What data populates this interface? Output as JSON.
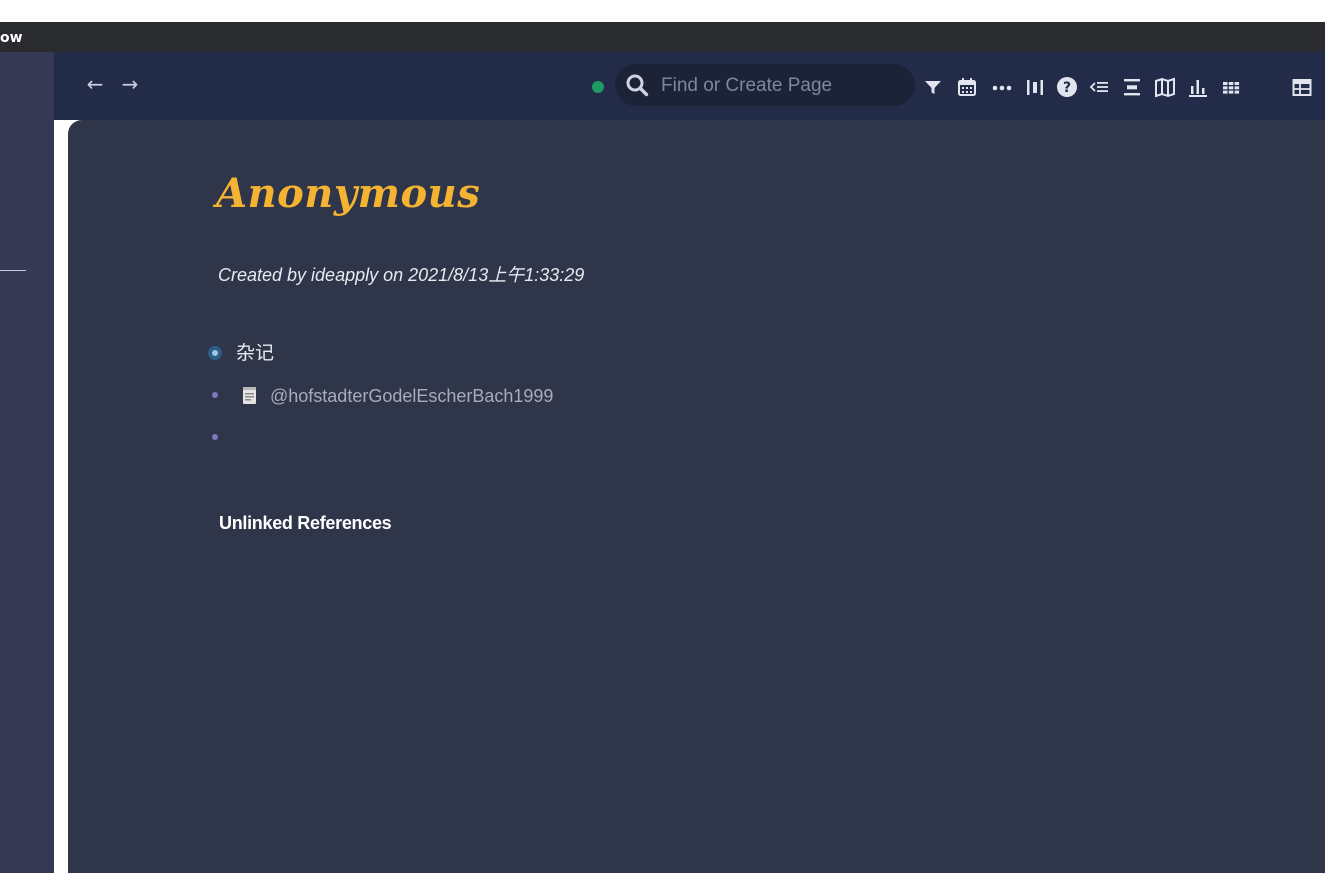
{
  "window": {
    "title": "ow"
  },
  "topbar": {
    "back_arrow": "←",
    "forward_arrow": "→",
    "search": {
      "placeholder": "Find or Create Page",
      "value": ""
    },
    "icons": [
      "filter-icon",
      "calendar-icon",
      "more-icon",
      "columns-icon",
      "help-icon",
      "outdent-icon",
      "align-center-icon",
      "book-icon",
      "bar-chart-icon",
      "grid-icon",
      "table-icon"
    ],
    "sync_status_color": "#1f9a64"
  },
  "page": {
    "title": "Anonymous",
    "created": "Created by ideapply on 2021/8/13上午1:33:29",
    "blocks": [
      {
        "text": "杂记"
      },
      {
        "text": "@hofstadterGodelEscherBach1999",
        "icon": "note-icon"
      },
      {
        "text": ""
      }
    ],
    "unlinked_references": "Unlinked References"
  },
  "colors": {
    "title": "#f5b332",
    "page_bg": "#30364a",
    "topbar_bg": "#222b48",
    "sidebar_bg": "#363954"
  }
}
